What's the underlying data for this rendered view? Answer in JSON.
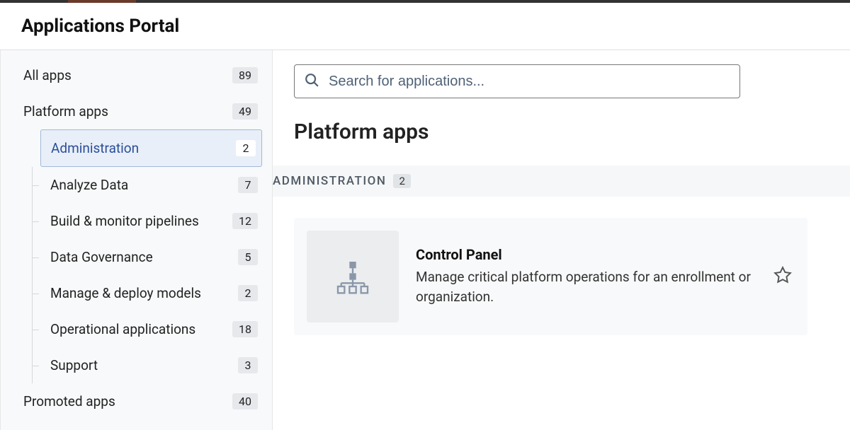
{
  "header": {
    "title": "Applications Portal"
  },
  "search": {
    "placeholder": "Search for applications..."
  },
  "sidebar": {
    "items": [
      {
        "label": "All apps",
        "count": "89",
        "level": 1,
        "selected": false
      },
      {
        "label": "Platform apps",
        "count": "49",
        "level": 1,
        "selected": false
      },
      {
        "label": "Administration",
        "count": "2",
        "level": 2,
        "selected": true
      },
      {
        "label": "Analyze Data",
        "count": "7",
        "level": 2,
        "selected": false
      },
      {
        "label": "Build & monitor pipelines",
        "count": "12",
        "level": 2,
        "selected": false
      },
      {
        "label": "Data Governance",
        "count": "5",
        "level": 2,
        "selected": false
      },
      {
        "label": "Manage & deploy models",
        "count": "2",
        "level": 2,
        "selected": false
      },
      {
        "label": "Operational applications",
        "count": "18",
        "level": 2,
        "selected": false
      },
      {
        "label": "Support",
        "count": "3",
        "level": 2,
        "selected": false
      },
      {
        "label": "Promoted apps",
        "count": "40",
        "level": 1,
        "selected": false
      }
    ]
  },
  "main": {
    "page_title": "Platform apps",
    "section": {
      "title": "ADMINISTRATION",
      "count": "2"
    },
    "apps": [
      {
        "icon": "org-chart-icon",
        "title": "Control Panel",
        "description": "Manage critical platform operations for an enrollment or organization."
      }
    ]
  }
}
